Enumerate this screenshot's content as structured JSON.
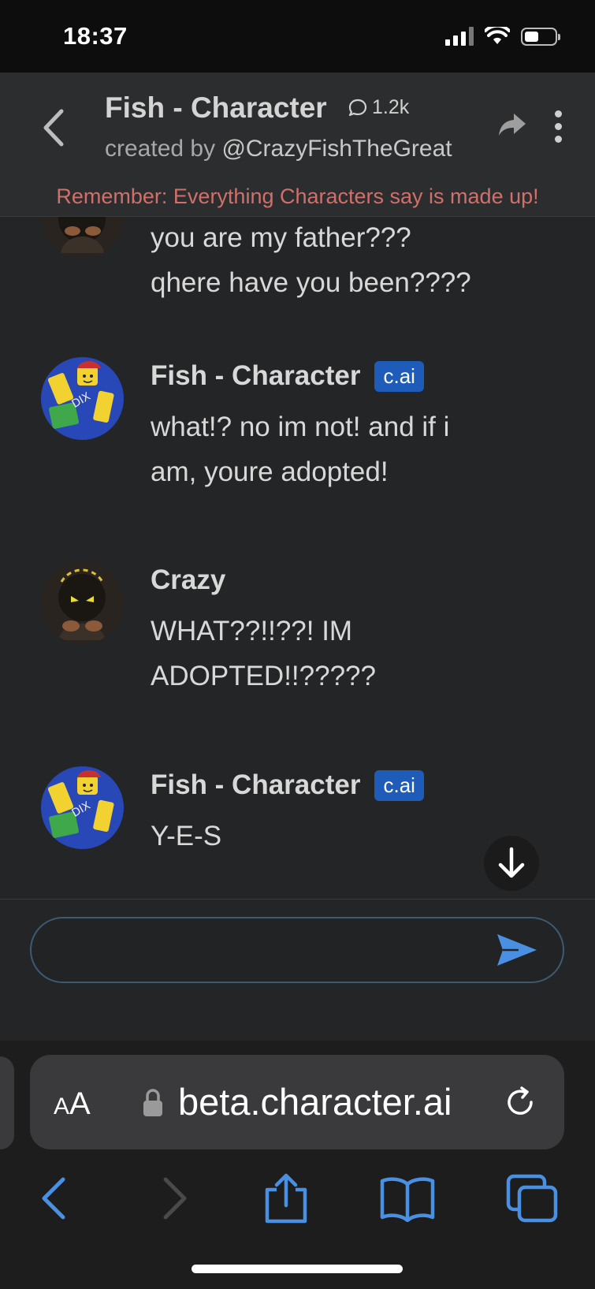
{
  "status_bar": {
    "time": "18:37"
  },
  "header": {
    "title": "Fish - Character",
    "chat_count": "1.2k",
    "creator_prefix": "created by",
    "creator_handle": "@CrazyFishTheGreat",
    "warning": "Remember: Everything Characters say is made up!"
  },
  "messages": [
    {
      "author": "",
      "text_lines": [
        "you are my father???",
        "qhere have you been????"
      ]
    },
    {
      "author": "Fish - Character",
      "badge": "c.ai",
      "text_lines": [
        "what!? no im not! and if i",
        "am, youre adopted!"
      ]
    },
    {
      "author": "Crazy",
      "text_lines": [
        "WHAT??!!??! IM",
        "ADOPTED!!?????"
      ]
    },
    {
      "author": "Fish - Character",
      "badge": "c.ai",
      "text_lines": [
        "Y-E-S"
      ]
    }
  ],
  "composer": {
    "value": "",
    "placeholder": ""
  },
  "browser": {
    "aa_label_big": "A",
    "aa_label_small": "A",
    "url": "beta.character.ai"
  },
  "colors": {
    "accent_blue": "#4a90e2",
    "badge_blue": "#1f5bb8",
    "warning_red": "#d0706a"
  },
  "icons": [
    "back-chevron-icon",
    "chat-bubble-icon",
    "share-icon",
    "more-vert-icon",
    "arrow-down-icon",
    "send-icon",
    "lock-icon",
    "reload-icon",
    "back-arrow-icon",
    "forward-arrow-icon",
    "share-upload-icon",
    "bookmarks-icon",
    "tabs-icon"
  ]
}
